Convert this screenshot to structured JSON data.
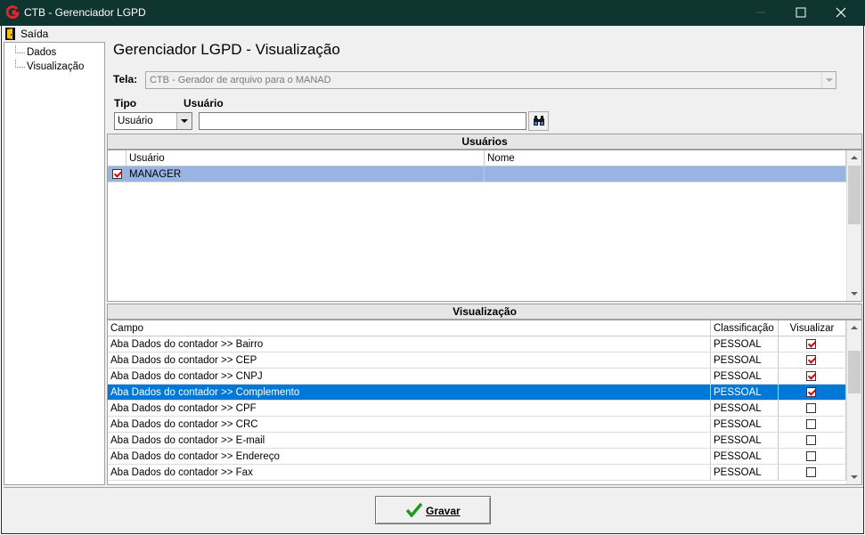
{
  "window": {
    "title": "CTB - Gerenciador LGPD",
    "icon": "ctb-app-icon",
    "controls": [
      "minimize-icon",
      "maximize-icon",
      "close-icon"
    ]
  },
  "menu": {
    "exit_label": "Saída"
  },
  "sidebar": {
    "items": [
      {
        "label": "Dados"
      },
      {
        "label": "Visualização"
      }
    ]
  },
  "page_title": "Gerenciador LGPD - Visualização",
  "form": {
    "tela_label": "Tela:",
    "tela_value": "CTB - Gerador de arquivo para o MANAD",
    "tipo_label": "Tipo",
    "tipo_value": "Usuário",
    "usuario_label": "Usuário",
    "usuario_value": ""
  },
  "users_section": {
    "title": "Usuários",
    "columns": [
      "Usuário",
      "Nome"
    ],
    "rows": [
      {
        "checked": true,
        "usuario": "MANAGER",
        "nome": ""
      }
    ]
  },
  "view_section": {
    "title": "Visualização",
    "columns": [
      "Campo",
      "Classificação",
      "Visualizar"
    ],
    "rows": [
      {
        "campo": "Aba Dados do contador >> Bairro",
        "classificacao": "PESSOAL",
        "visualizar": true
      },
      {
        "campo": "Aba Dados do contador >> CEP",
        "classificacao": "PESSOAL",
        "visualizar": true
      },
      {
        "campo": "Aba Dados do contador >> CNPJ",
        "classificacao": "PESSOAL",
        "visualizar": true
      },
      {
        "campo": "Aba Dados do contador >> Complemento",
        "classificacao": "PESSOAL",
        "visualizar": true,
        "selected": true
      },
      {
        "campo": "Aba Dados do contador >> CPF",
        "classificacao": "PESSOAL",
        "visualizar": false
      },
      {
        "campo": "Aba Dados do contador >> CRC",
        "classificacao": "PESSOAL",
        "visualizar": false
      },
      {
        "campo": "Aba Dados do contador >> E-mail",
        "classificacao": "PESSOAL",
        "visualizar": false
      },
      {
        "campo": "Aba Dados do contador >> Endereço",
        "classificacao": "PESSOAL",
        "visualizar": false
      },
      {
        "campo": "Aba Dados do contador >> Fax",
        "classificacao": "PESSOAL",
        "visualizar": false
      }
    ]
  },
  "footer": {
    "save_label": "Gravar"
  },
  "colors": {
    "titlebar": "#0f3530",
    "selection_light": "#9ab4e2",
    "selection_dark": "#0078d7",
    "check_mark": "#dd0000",
    "save_check": "#1e9a1e"
  }
}
